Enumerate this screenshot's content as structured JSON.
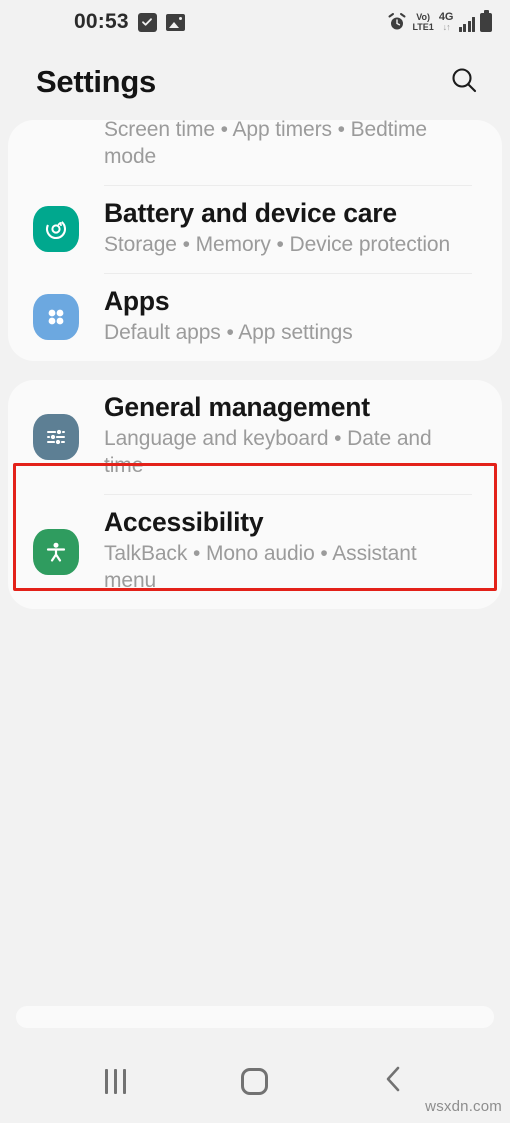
{
  "status_bar": {
    "clock": "00:53",
    "icons_left": [
      "checkbox-icon",
      "image-icon"
    ],
    "alarm_icon": "alarm-clock-icon",
    "volte_line1": "Vo)",
    "volte_line2": "LTE1",
    "network_type": "4G",
    "data_arrows": "↓↑",
    "signal_icon": "signal-bars-icon",
    "battery_icon": "battery-full-icon"
  },
  "header": {
    "title": "Settings",
    "search_icon": "search-icon"
  },
  "cards": [
    {
      "rows": [
        {
          "id": "digital-wellbeing",
          "title": "",
          "subtitle": "Screen time  •  App timers  •  Bedtime mode",
          "icon": "hourglass-icon",
          "icon_color": "",
          "partial": true
        },
        {
          "id": "battery-and-device-care",
          "title": "Battery and device care",
          "subtitle": "Storage  •  Memory  •  Device protection",
          "icon": "device-care-icon",
          "icon_color": "#00a88e",
          "partial": false
        },
        {
          "id": "apps",
          "title": "Apps",
          "subtitle": "Default apps  •  App settings",
          "icon": "apps-grid-icon",
          "icon_color": "#6ca8e0",
          "partial": false
        }
      ]
    },
    {
      "rows": [
        {
          "id": "general-management",
          "title": "General management",
          "subtitle": "Language and keyboard  •  Date and time",
          "icon": "sliders-icon",
          "icon_color": "#5d7f94",
          "partial": false
        },
        {
          "id": "accessibility",
          "title": "Accessibility",
          "subtitle": "TalkBack  •  Mono audio  •  Assistant menu",
          "icon": "accessibility-person-icon",
          "icon_color": "#2f9c5f",
          "partial": false
        }
      ]
    }
  ],
  "highlight": {
    "target": "apps",
    "color": "#e32119"
  },
  "navigation_bar": {
    "recents_label": "recents-icon",
    "home_label": "home-icon",
    "back_label": "back-icon"
  },
  "watermark": "wsxdn.com"
}
